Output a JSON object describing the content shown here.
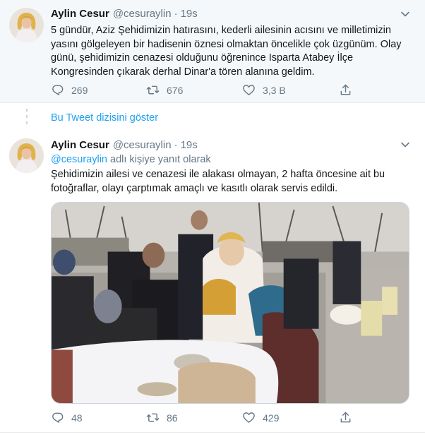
{
  "tweet1": {
    "author_name": "Aylin Cesur",
    "handle": "@cesuraylin",
    "separator": "·",
    "time": "19s",
    "text": "5 gündür, Aziz Şehidimizin hatırasını, kederli ailesinin acısını ve milletimizin yasını gölgeleyen bir hadisenin öznesi olmaktan öncelikle çok üzgünüm. Olay günü, şehidimizin cenazesi olduğunu öğrenince Isparta Atabey İlçe Kongresinden çıkarak derhal Dinar'a tören alanına geldim.",
    "replies": "269",
    "retweets": "676",
    "likes": "3,3 B"
  },
  "show_thread": "Bu Tweet dizisini göster",
  "tweet2": {
    "author_name": "Aylin Cesur",
    "handle": "@cesuraylin",
    "separator": "·",
    "time": "19s",
    "reply_mention": "@cesuraylin",
    "reply_suffix": " adlı kişiye yanıt olarak",
    "text": "Şehidimizin ailesi ve cenazesi ile alakası olmayan, 2 hafta öncesine ait bu fotoğraflar, olayı çarptımak amaçlı ve kasıtlı olarak servis edildi.",
    "replies": "48",
    "retweets": "86",
    "likes": "429"
  },
  "icons": {
    "reply": "reply-icon",
    "retweet": "retweet-icon",
    "like": "heart-icon",
    "share": "share-icon",
    "caret": "chevron-down-icon"
  },
  "colors": {
    "accent": "#1da1f2",
    "muted": "#657786",
    "highlight_bg": "#f5f8fa"
  }
}
